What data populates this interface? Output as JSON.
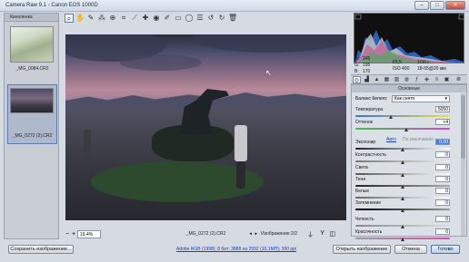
{
  "window": {
    "title": "Camera Raw 9.1  -  Canon EOS 1000D",
    "min": "–",
    "max": "□",
    "close": "✕"
  },
  "filmstrip": {
    "header": "Киноленка",
    "items": [
      {
        "caption": "_MG_0084.CR2",
        "stars": ""
      },
      {
        "caption": "_MG_0272 (2).CR2",
        "stars": "· · · · ·"
      }
    ]
  },
  "toolbar": {
    "tools": [
      "zoom-tool-icon",
      "hand-tool-icon",
      "white-balance-icon",
      "color-sampler-icon",
      "target-adjust-icon",
      "crop-icon",
      "straighten-icon",
      "spot-removal-icon",
      "red-eye-icon",
      "adjustment-brush-icon",
      "graduated-filter-icon",
      "radial-filter-icon",
      "preferences-icon",
      "rotate-left-icon",
      "rotate-right-icon",
      "trash-icon"
    ]
  },
  "image": {
    "filename": "_MG_0272 (2).CR2",
    "zoom": "19,4%",
    "pager": "Изображение 2/2"
  },
  "readout": {
    "r": "R:",
    "g": "G:",
    "b": "B:",
    "rv": "245",
    "gv": "195",
    "bv": "170",
    "aperture": "f/3,5",
    "shutter": "1/30 с",
    "iso": "ISO 400",
    "focal": "18-55@20 мм"
  },
  "panel": {
    "title": "Основные",
    "wb_label": "Баланс белого:",
    "wb_value": "Как снято",
    "temp_label": "Температура",
    "temp_value": "5050",
    "tint_label": "Оттенок",
    "tint_value": "+4",
    "auto_link": "Авто",
    "default_link": "По умолчанию",
    "sliders": [
      {
        "label": "Экспонир",
        "value": "0,00",
        "pos": 0.5
      },
      {
        "label": "Контрастность",
        "value": "0",
        "pos": 0.5
      },
      {
        "label": "Света",
        "value": "0",
        "pos": 0.5
      },
      {
        "label": "Тени",
        "value": "0",
        "pos": 0.5
      },
      {
        "label": "Белые",
        "value": "0",
        "pos": 0.5
      },
      {
        "label": "Затемнение",
        "value": "0",
        "pos": 0.5
      },
      {
        "label": "Четкость",
        "value": "0",
        "pos": 0.5
      },
      {
        "label": "Красочность",
        "value": "0",
        "pos": 0.5
      }
    ]
  },
  "footer": {
    "save": "Сохранить изображение...",
    "workflow": "Adobe RGB (1998); 8 бит; 3888 на 2592 (10,1МП); 300 ppi",
    "open": "Открыть изображение",
    "cancel": "Отмена",
    "done": "Готово"
  },
  "colors": {
    "accent": "#4a7fcf",
    "link": "#1a3fb0"
  }
}
